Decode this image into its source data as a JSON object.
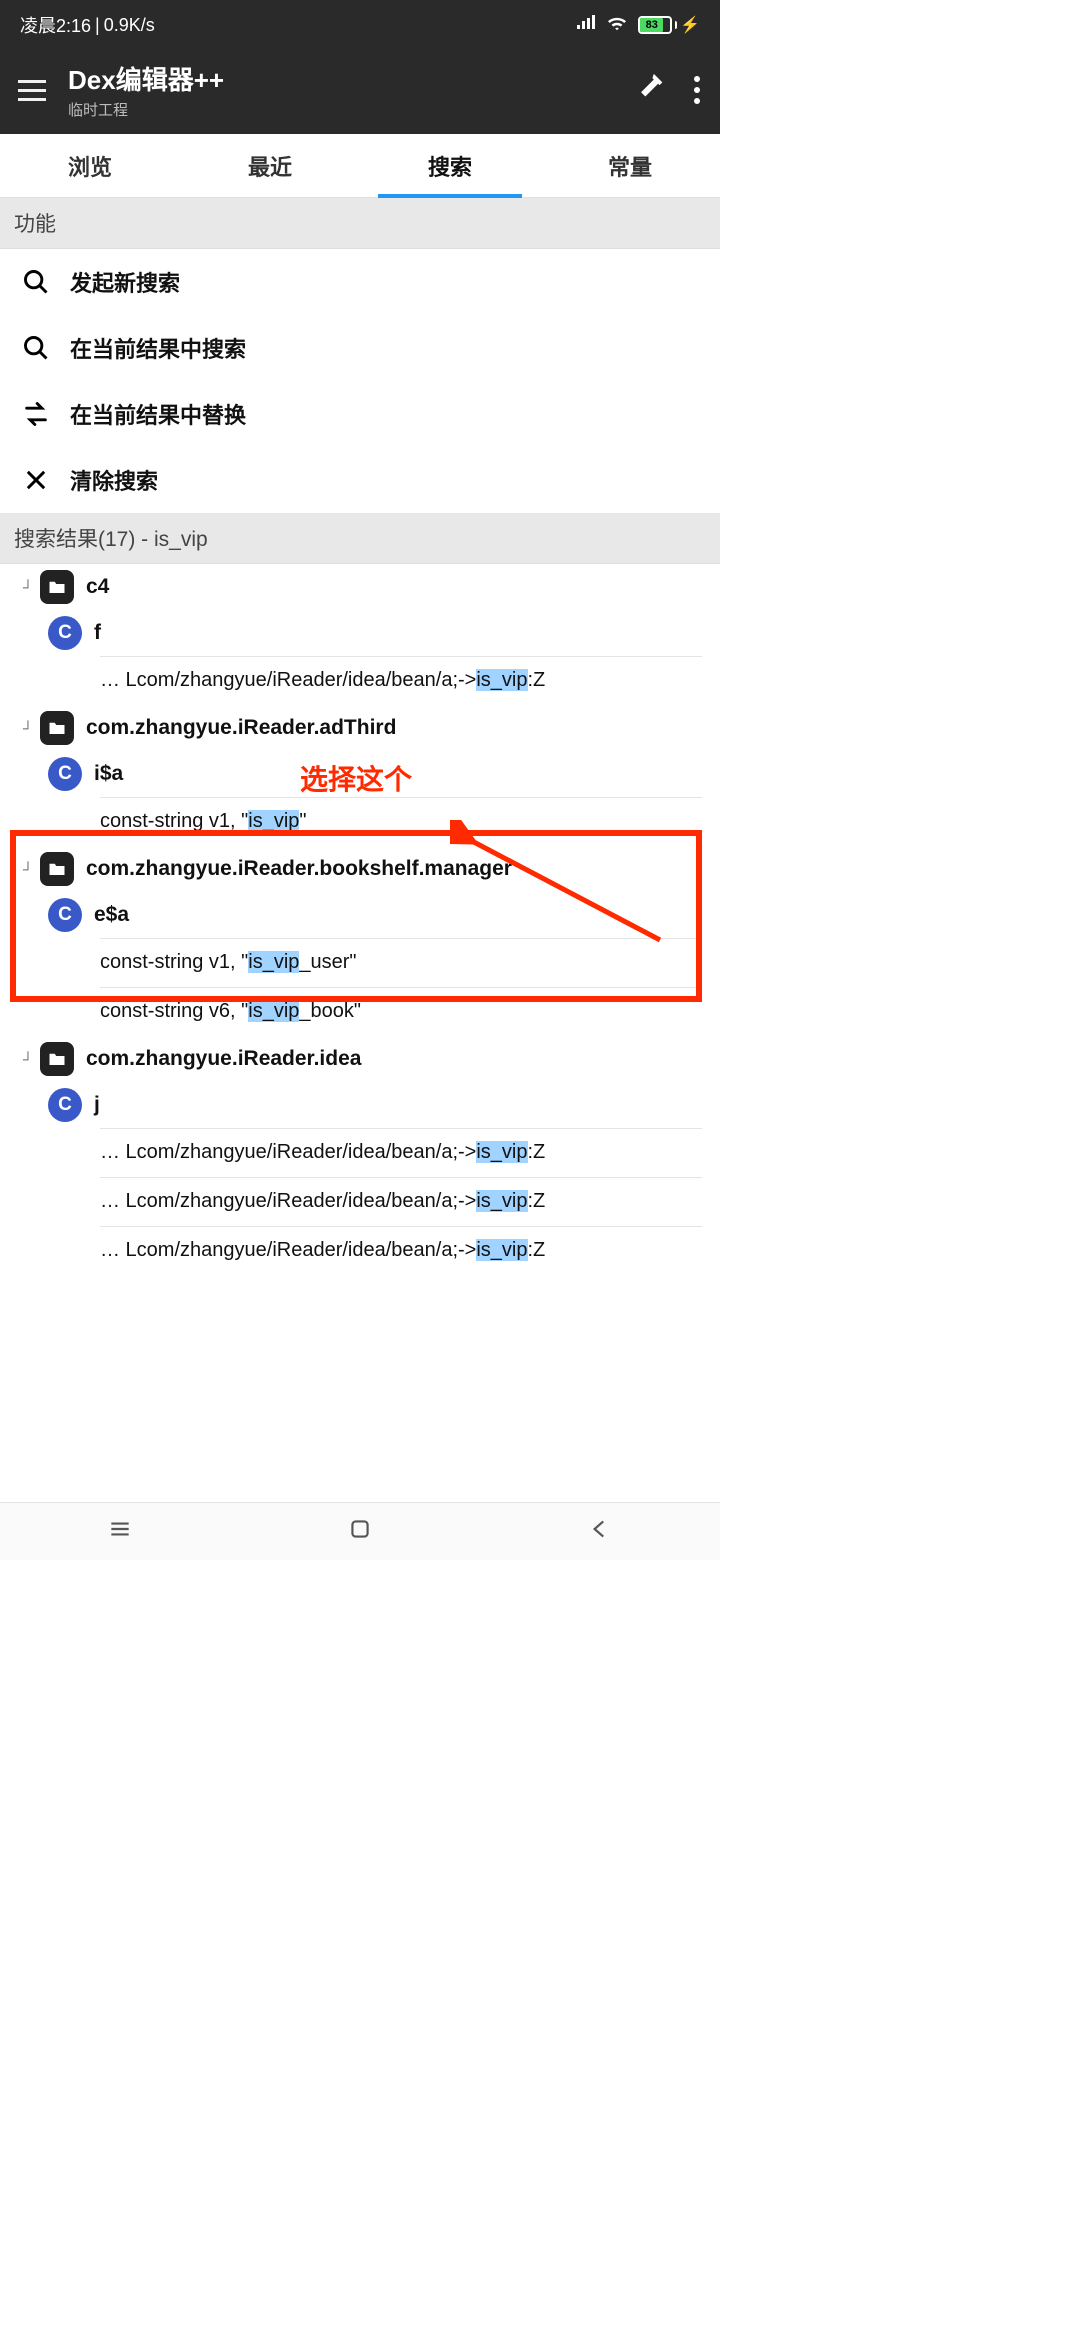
{
  "statusbar": {
    "time": "凌晨2:16",
    "speed": "0.9K/s",
    "battery": "83"
  },
  "appbar": {
    "title": "Dex编辑器++",
    "subtitle": "临时工程"
  },
  "tabs": [
    "浏览",
    "最近",
    "搜索",
    "常量"
  ],
  "active_tab_index": 2,
  "sections": {
    "actions_header": "功能",
    "results_header": "搜索结果(17) - is_vip"
  },
  "actions": [
    {
      "icon": "search",
      "label": "发起新搜索"
    },
    {
      "icon": "search",
      "label": "在当前结果中搜索"
    },
    {
      "icon": "swap",
      "label": "在当前结果中替换"
    },
    {
      "icon": "close",
      "label": "清除搜索"
    }
  ],
  "results": [
    {
      "package": "c4",
      "classes": [
        {
          "name": "f",
          "lines": [
            {
              "prefix": "… Lcom/zhangyue/iReader/idea/bean/a;->",
              "hl": "is_vip",
              "suffix": ":Z"
            }
          ]
        }
      ]
    },
    {
      "package": "com.zhangyue.iReader.adThird",
      "classes": [
        {
          "name": "i$a",
          "lines": [
            {
              "prefix": "const-string v1, \"",
              "hl": "is_vip",
              "suffix": "\""
            }
          ]
        }
      ]
    },
    {
      "package": "com.zhangyue.iReader.bookshelf.manager",
      "classes": [
        {
          "name": "e$a",
          "lines": [
            {
              "prefix": "const-string v1, \"",
              "hl": "is_vip",
              "suffix": "_user\""
            },
            {
              "prefix": "const-string v6, \"",
              "hl": "is_vip",
              "suffix": "_book\""
            }
          ]
        }
      ]
    },
    {
      "package": "com.zhangyue.iReader.idea",
      "classes": [
        {
          "name": "j",
          "lines": [
            {
              "prefix": "… Lcom/zhangyue/iReader/idea/bean/a;->",
              "hl": "is_vip",
              "suffix": ":Z"
            },
            {
              "prefix": "… Lcom/zhangyue/iReader/idea/bean/a;->",
              "hl": "is_vip",
              "suffix": ":Z"
            },
            {
              "prefix": "… Lcom/zhangyue/iReader/idea/bean/a;->",
              "hl": "is_vip",
              "suffix": ":Z"
            }
          ]
        }
      ]
    }
  ],
  "annotation": {
    "label": "选择这个"
  }
}
